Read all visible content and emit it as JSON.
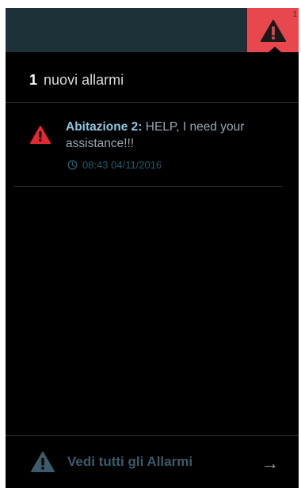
{
  "topbar": {
    "alarm_count": "1"
  },
  "panel": {
    "count": "1",
    "title": "nuovi allarmi"
  },
  "alarms": [
    {
      "source": "Abitazione 2:",
      "message": "HELP, I need your assistance!!!",
      "time": "08:43 04/11/2016"
    }
  ],
  "footer": {
    "link_label": "Vedi tutti gli Allarmi",
    "arrow": "→"
  },
  "icons": {
    "alarm": "warning-triangle",
    "time": "clock",
    "arrow": "arrow-right"
  },
  "colors": {
    "topbar": "#1c3238",
    "alarm_button": "#e8474e",
    "alarm_icon_item": "#e02a30",
    "source": "#8ec7df",
    "time": "#1f5c6b",
    "footer_link": "#3b5b6a"
  }
}
